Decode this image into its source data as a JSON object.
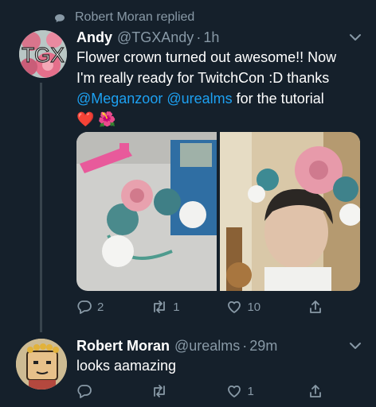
{
  "context": {
    "replied_by": "Robert Moran replied"
  },
  "tweet1": {
    "avatar_text": "TGX",
    "name": "Andy",
    "handle": "@TGXAndy",
    "dot": "·",
    "time": "1h",
    "line1": "Flower crown turned out awesome!! Now",
    "line2": "I'm really ready for TwitchCon :D thanks",
    "mention1": "@Meganzoor",
    "mention2": "@urealms",
    "line3_tail": "for the tutorial",
    "emojis": "❤️ 🌺",
    "replies": "2",
    "retweets": "1",
    "likes": "10"
  },
  "tweet2": {
    "name": "Robert Moran",
    "handle": "@urealms",
    "dot": "·",
    "time": "29m",
    "text": "looks aamazing",
    "replies": "",
    "retweets": "",
    "likes": "1"
  },
  "colors": {
    "background": "#15202b",
    "secondary_text": "#8899a6",
    "link": "#1da1f2",
    "thread_line": "#38444d"
  },
  "icons": [
    "comment-bubble-icon",
    "chevron-down-icon",
    "reply-icon",
    "retweet-icon",
    "heart-icon",
    "share-icon"
  ]
}
